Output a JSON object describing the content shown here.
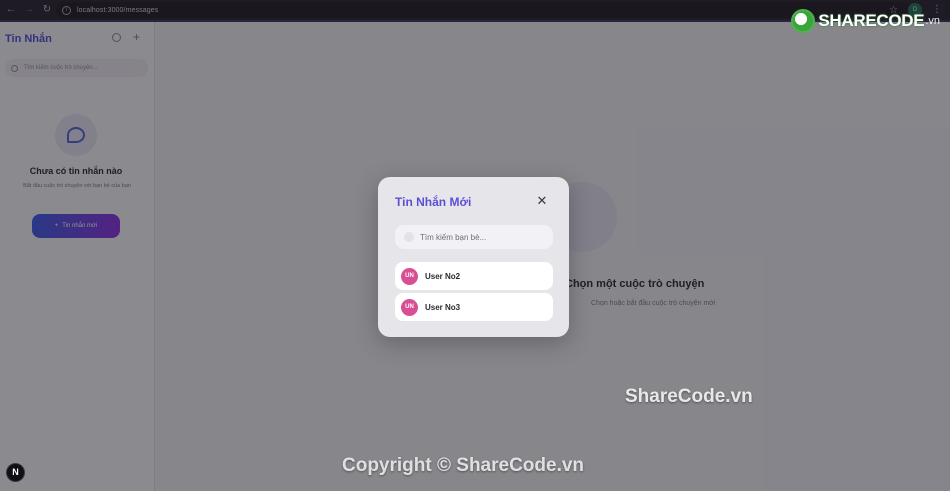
{
  "browser": {
    "url": "localhost:3000/messages",
    "profile_initial": "D"
  },
  "modal": {
    "title": "Tin Nhắn Mới",
    "search_placeholder": "Tìm kiếm bạn bè...",
    "users": [
      {
        "initials": "UN",
        "name": "User No2"
      },
      {
        "initials": "UN",
        "name": "User No3"
      }
    ]
  },
  "sidebar": {
    "title": "Tin Nhắn",
    "search_placeholder": "Tìm kiếm cuộc trò chuyện...",
    "empty_title": "Chưa có tin nhắn nào",
    "empty_desc": "Bắt đầu cuộc trò chuyện với bạn bè của bạn",
    "new_button": "Tin nhắn mới"
  },
  "main": {
    "empty_title": "Chọn một cuộc trò chuyện",
    "empty_desc": "Chọn hoặc bắt đầu cuộc trò chuyện mới"
  },
  "badge": {
    "label": "N"
  },
  "watermarks": {
    "logo_text": "SHARECODE",
    "logo_tld": ".vn",
    "mid": "ShareCode.vn",
    "bottom": "Copyright © ShareCode.vn"
  },
  "colors": {
    "accent": "#5b4fd6",
    "avatar": "#d94f93",
    "chrome": "#27222e"
  }
}
